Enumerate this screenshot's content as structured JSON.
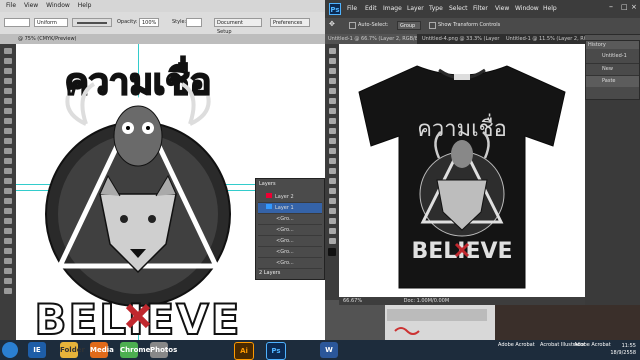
{
  "illustrator": {
    "menu": [
      "File",
      "View",
      "Window",
      "Help"
    ],
    "control": {
      "stroke_style": "Uniform",
      "opacity_label": "Opacity:",
      "opacity_value": "100%",
      "style_label": "Style:",
      "document_setup": "Document Setup",
      "preferences": "Preferences"
    },
    "doc_tab": "@ 75% (CMYK/Preview)",
    "artwork": {
      "headline": "ความเชื่อ",
      "footer": "BELIEVE"
    },
    "layers_panel": {
      "title": "Layers",
      "rows": [
        "Layer 2",
        "Layer 1",
        "<Gro...",
        "<Gro...",
        "<Gro...",
        "<Gro...",
        "<Gro..."
      ],
      "count": "2 Layers"
    }
  },
  "photoshop": {
    "logo": "Ps",
    "menu": [
      "File",
      "Edit",
      "Image",
      "Layer",
      "Type",
      "Select",
      "Filter",
      "View",
      "Window",
      "Help"
    ],
    "options": {
      "auto_select": "Auto-Select:",
      "group": "Group",
      "transform": "Show Transform Controls"
    },
    "tabs": [
      "Untitled-1 @ 66.7% (Layer 2, RGB/8) *",
      "Untitled-4.png @ 33.3% (Layer 0, RGB/8)",
      "Untitled-1 @ 11.5% (Layer 2, RGB/8)"
    ],
    "status": {
      "zoom": "66.67%",
      "doc": "Doc: 1.00M/0.00M"
    },
    "history": {
      "title": "History",
      "items": [
        "Untitled-1",
        "New",
        "Paste"
      ]
    },
    "artwork": {
      "headline": "ความเชื่อ",
      "footer": "BELIEVE"
    }
  },
  "taskbar": {
    "apps": [
      "IE",
      "Folder",
      "Media",
      "Chrome",
      "Photos",
      "Ai",
      "Ps",
      "W"
    ],
    "thumbs": [
      "Adobe Acrobat",
      "Acrobat Illustrator",
      "Adobe Acrobat"
    ],
    "time": "11:55",
    "date": "18/9/2558"
  },
  "colors": {
    "guide": "#33cccc",
    "shirt": "#141414",
    "accent": "#c0282e"
  }
}
